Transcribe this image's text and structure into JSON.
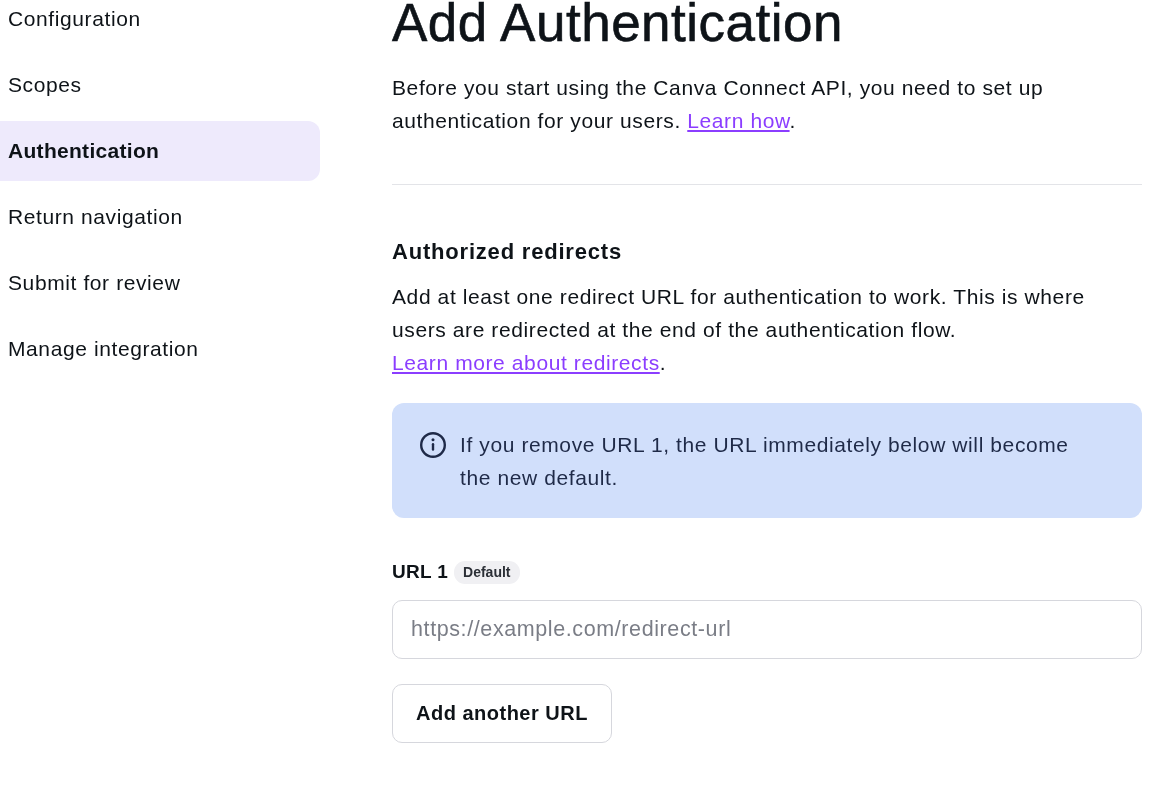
{
  "sidebar": {
    "items": [
      {
        "label": "Configuration",
        "selected": false
      },
      {
        "label": "Scopes",
        "selected": false
      },
      {
        "label": "Authentication",
        "selected": true
      },
      {
        "label": "Return navigation",
        "selected": false
      },
      {
        "label": "Submit for review",
        "selected": false
      },
      {
        "label": "Manage integration",
        "selected": false
      }
    ]
  },
  "main": {
    "title": "Add Authentication",
    "intro": {
      "text": "Before you start using the Canva Connect API, you need to set up authentication for your users.",
      "link": "Learn how",
      "tail": "."
    }
  },
  "authorized_redirects": {
    "heading": "Authorized redirects",
    "description": {
      "text": "Add at least one redirect URL for authentication to work. This is where users are redirected at the end of the authentication flow.",
      "link": "Learn more about redirects",
      "tail": "."
    },
    "notice": {
      "text": "If you remove URL 1, the URL immediately below will become the new default."
    },
    "urls": [
      {
        "label": "URL 1",
        "badge": "Default",
        "placeholder": "https://example.com/redirect-url"
      }
    ],
    "add_button": "Add another URL"
  }
}
